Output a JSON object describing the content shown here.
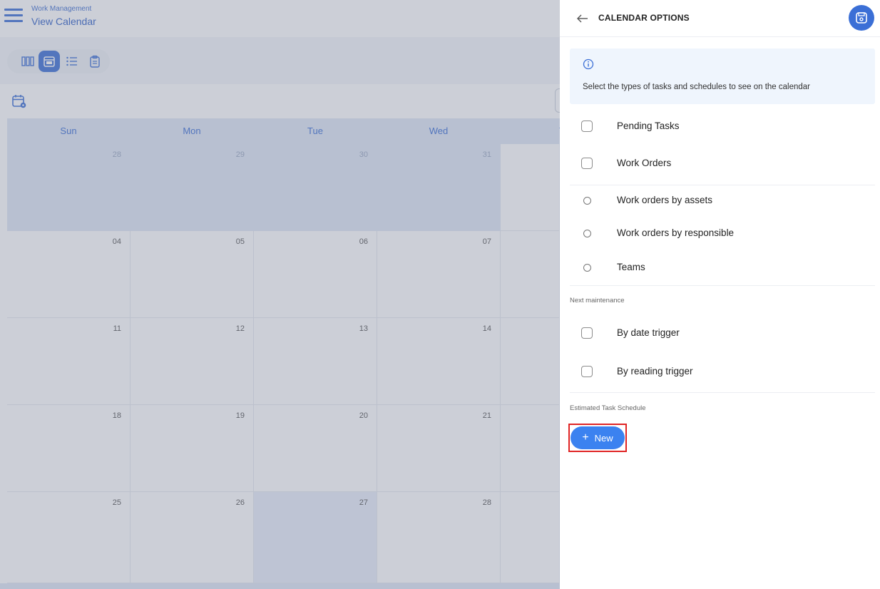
{
  "app": {
    "breadcrumb_module": "Work Management",
    "breadcrumb_page": "View Calendar"
  },
  "calendar": {
    "weekdays": [
      "Sun",
      "Mon",
      "Tue",
      "Wed",
      "T"
    ],
    "weeks": [
      [
        "28",
        "29",
        "30",
        "31",
        ""
      ],
      [
        "04",
        "05",
        "06",
        "07",
        ""
      ],
      [
        "11",
        "12",
        "13",
        "14",
        ""
      ],
      [
        "18",
        "19",
        "20",
        "21",
        ""
      ],
      [
        "25",
        "26",
        "27",
        "28",
        ""
      ]
    ]
  },
  "panel": {
    "title": "CALENDAR OPTIONS",
    "info_text": "Select the types of tasks and schedules to see on the calendar",
    "options": {
      "pending_tasks": "Pending Tasks",
      "work_orders": "Work Orders",
      "by_assets": "Work orders by assets",
      "by_responsible": "Work orders by responsible",
      "teams": "Teams"
    },
    "next_maintenance_label": "Next maintenance",
    "maintenance": {
      "by_date": "By date trigger",
      "by_reading": "By reading trigger"
    },
    "estimated_label": "Estimated Task Schedule",
    "new_button": "New"
  },
  "colors": {
    "primary": "#3b6fd6",
    "new_button": "#3b82f0",
    "highlight_frame": "#e02424"
  }
}
